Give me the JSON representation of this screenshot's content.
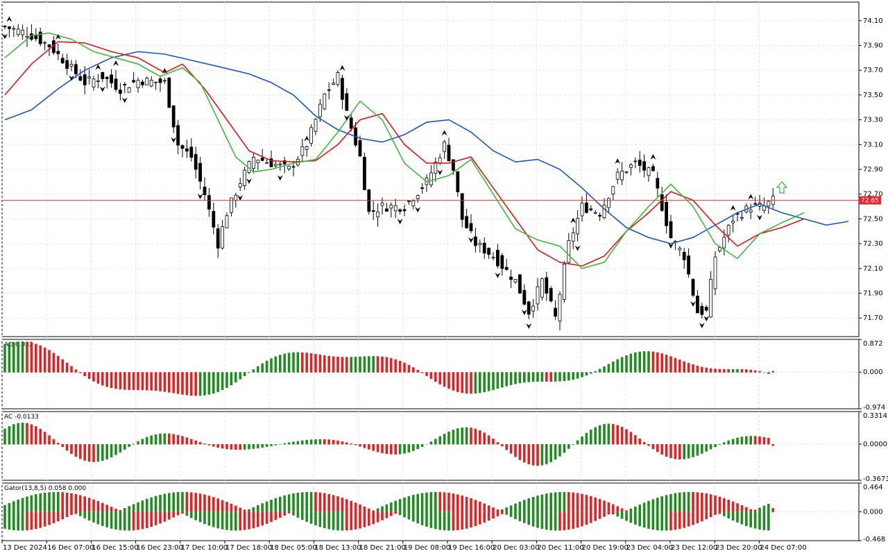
{
  "colors": {
    "background": "#ffffff",
    "grid": "#e4e4e4",
    "bull_candle": "#ffffff",
    "bear_candle": "#000000",
    "jaw": "#1656c9",
    "teeth": "#e01616",
    "lips": "#3bbb3b",
    "up_bar": "#1e8c1e",
    "down_bar": "#e02222",
    "price_line": "#d83838",
    "fractal_arrow": "#000000",
    "signal_arrow": "#3bbb3b"
  },
  "chart_data": [
    {
      "type": "candlestick",
      "panel": "main",
      "current_price": "72.65",
      "ylim": [
        71.55,
        74.25
      ],
      "y_ticks": [
        "74.10",
        "73.90",
        "73.70",
        "73.50",
        "73.30",
        "73.10",
        "72.90",
        "72.70",
        "72.50",
        "72.30",
        "72.10",
        "71.90",
        "71.70"
      ],
      "x_labels": [
        "13 Dec 2024",
        "16 Dec 07:00",
        "16 Dec 15:00",
        "16 Dec 23:00",
        "17 Dec 10:00",
        "17 Dec 18:00",
        "18 Dec 05:00",
        "18 Dec 13:00",
        "18 Dec 21:00",
        "19 Dec 08:00",
        "19 Dec 16:00",
        "20 Dec 03:00",
        "20 Dec 11:00",
        "20 Dec 19:00",
        "23 Dec 04:00",
        "23 Dec 12:00",
        "23 Dec 20:00",
        "24 Dec 07:00"
      ],
      "alligator": {
        "jaw": [
          [
            0,
            73.3
          ],
          [
            6,
            73.38
          ],
          [
            12,
            73.55
          ],
          [
            18,
            73.7
          ],
          [
            24,
            73.8
          ],
          [
            30,
            73.85
          ],
          [
            36,
            73.83
          ],
          [
            42,
            73.78
          ],
          [
            48,
            73.73
          ],
          [
            55,
            73.67
          ],
          [
            60,
            73.6
          ],
          [
            65,
            73.5
          ],
          [
            70,
            73.33
          ],
          [
            75,
            73.22
          ],
          [
            80,
            73.15
          ],
          [
            85,
            73.12
          ],
          [
            90,
            73.18
          ],
          [
            95,
            73.28
          ],
          [
            100,
            73.3
          ],
          [
            105,
            73.2
          ],
          [
            110,
            73.05
          ],
          [
            115,
            72.96
          ],
          [
            120,
            72.98
          ],
          [
            125,
            72.9
          ],
          [
            130,
            72.75
          ],
          [
            135,
            72.58
          ],
          [
            140,
            72.43
          ],
          [
            145,
            72.35
          ],
          [
            150,
            72.3
          ],
          [
            155,
            72.35
          ],
          [
            160,
            72.45
          ],
          [
            165,
            72.55
          ],
          [
            170,
            72.62
          ],
          [
            175,
            72.55
          ],
          [
            180,
            72.5
          ],
          [
            185,
            72.45
          ],
          [
            190,
            72.48
          ]
        ],
        "teeth": [
          [
            0,
            73.5
          ],
          [
            6,
            73.75
          ],
          [
            12,
            73.93
          ],
          [
            18,
            73.92
          ],
          [
            24,
            73.85
          ],
          [
            30,
            73.8
          ],
          [
            36,
            73.68
          ],
          [
            40,
            73.75
          ],
          [
            45,
            73.55
          ],
          [
            50,
            73.3
          ],
          [
            55,
            73.05
          ],
          [
            60,
            72.97
          ],
          [
            65,
            72.96
          ],
          [
            70,
            72.97
          ],
          [
            75,
            73.1
          ],
          [
            80,
            73.3
          ],
          [
            85,
            73.35
          ],
          [
            90,
            73.1
          ],
          [
            95,
            72.95
          ],
          [
            100,
            72.95
          ],
          [
            105,
            73.0
          ],
          [
            110,
            72.75
          ],
          [
            115,
            72.5
          ],
          [
            120,
            72.25
          ],
          [
            125,
            72.15
          ],
          [
            130,
            72.12
          ],
          [
            135,
            72.2
          ],
          [
            140,
            72.4
          ],
          [
            145,
            72.55
          ],
          [
            150,
            72.72
          ],
          [
            155,
            72.65
          ],
          [
            160,
            72.45
          ],
          [
            165,
            72.28
          ],
          [
            170,
            72.38
          ],
          [
            175,
            72.43
          ],
          [
            180,
            72.5
          ]
        ],
        "lips": [
          [
            0,
            73.8
          ],
          [
            6,
            73.98
          ],
          [
            10,
            74.0
          ],
          [
            15,
            73.95
          ],
          [
            20,
            73.85
          ],
          [
            25,
            73.8
          ],
          [
            30,
            73.75
          ],
          [
            35,
            73.65
          ],
          [
            40,
            73.72
          ],
          [
            44,
            73.6
          ],
          [
            48,
            73.3
          ],
          [
            52,
            73.0
          ],
          [
            56,
            72.88
          ],
          [
            60,
            72.9
          ],
          [
            65,
            72.95
          ],
          [
            70,
            72.98
          ],
          [
            75,
            73.2
          ],
          [
            80,
            73.45
          ],
          [
            85,
            73.3
          ],
          [
            90,
            72.95
          ],
          [
            95,
            72.8
          ],
          [
            100,
            72.85
          ],
          [
            105,
            72.98
          ],
          [
            110,
            72.7
          ],
          [
            115,
            72.42
          ],
          [
            120,
            72.33
          ],
          [
            125,
            72.28
          ],
          [
            130,
            72.1
          ],
          [
            135,
            72.15
          ],
          [
            140,
            72.4
          ],
          [
            145,
            72.6
          ],
          [
            150,
            72.78
          ],
          [
            155,
            72.6
          ],
          [
            160,
            72.3
          ],
          [
            165,
            72.18
          ],
          [
            170,
            72.38
          ],
          [
            175,
            72.47
          ],
          [
            180,
            72.55
          ]
        ]
      },
      "fractals_up_index": [
        1,
        12,
        21,
        25,
        36,
        68,
        76,
        99,
        128,
        138,
        146,
        164,
        168
      ],
      "fractals_down_index": [
        0,
        15,
        22,
        27,
        38,
        44,
        53,
        55,
        62,
        77,
        89,
        93,
        98,
        105,
        111,
        117,
        118,
        129,
        150,
        155,
        157,
        158,
        170
      ],
      "signal_arrow_index": 175
    },
    {
      "type": "bar",
      "panel": "AO",
      "label": "AO 0.032",
      "y_ticks": [
        "0.872",
        "0.000",
        "-0.974"
      ],
      "ylim": [
        -0.974,
        0.872
      ]
    },
    {
      "type": "bar",
      "panel": "AC",
      "label": "AC -0.0133",
      "y_ticks": [
        "0.3314",
        "0.0000",
        "-0.3673"
      ],
      "ylim": [
        -0.3673,
        0.3314
      ]
    },
    {
      "type": "bar",
      "panel": "Gator",
      "label": "Gator(13,8,5) 0.058 0.000",
      "y_ticks": [
        "0.464",
        "0.000",
        "-0.468"
      ],
      "ylim": [
        -0.468,
        0.464
      ]
    }
  ]
}
